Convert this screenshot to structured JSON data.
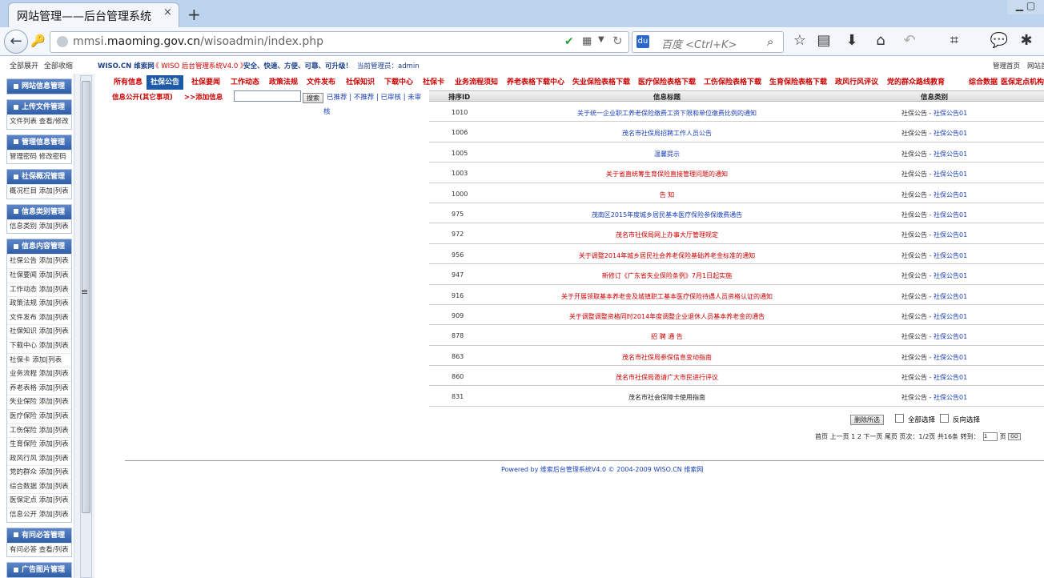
{
  "browser": {
    "tab_title": "网站管理——后台管理系统",
    "tab_close": "×",
    "new_tab": "+",
    "window_controls": "▁ ▢",
    "url_host_prefix": "mmsi.",
    "url_host_main": "maoming.gov.cn",
    "url_path": "/wisoadmin/index.php",
    "search_placeholder": "百度 <Ctrl+K>",
    "search_engine_label": "du"
  },
  "top_left": {
    "expand_all": "全部展开",
    "collapse_all": "全部收缩"
  },
  "header": {
    "brand": "WISO.CN 维索网",
    "version": "《 WISO 后台管理系统V4.0 》",
    "slogan": "安全、快速、方便、可靠、可升级！",
    "admin_label": "当前管理员：admin",
    "admin_home": "管理首页",
    "site_home": "网站首"
  },
  "sidebar": [
    {
      "title": "网站信息管理",
      "rows": []
    },
    {
      "title": "上传文件管理",
      "rows": [
        "文件列表  查看/修改"
      ]
    },
    {
      "title": "管理信息管理",
      "rows": [
        "管理密码  修改密码"
      ]
    },
    {
      "title": "社保概况管理",
      "rows": [
        "概况栏目   添加|列表"
      ]
    },
    {
      "title": "信息类别管理",
      "rows": [
        "信息类别  添加|列表"
      ]
    },
    {
      "title": "信息内容管理",
      "rows": [
        "社保公告  添加|列表",
        "社保要闻  添加|列表",
        "工作动态  添加|列表",
        "政策法规  添加|列表",
        "文件发布  添加|列表",
        "社保知识  添加|列表",
        "下载中心  添加|列表",
        "  社保卡  添加|列表",
        "业务流程  添加|列表",
        "养老表格  添加|列表",
        "失业保险  添加|列表",
        "医疗保险  添加|列表",
        "工伤保险  添加|列表",
        "生育保险  添加|列表",
        "政风行风  添加|列表",
        "党的群众  添加|列表",
        "综合数据  添加|列表",
        "医保定点  添加|列表",
        "信息公开  添加|列表"
      ]
    },
    {
      "title": "有问必答管理",
      "rows": [
        "有问必答  查看/列表"
      ]
    },
    {
      "title": "广告图片管理",
      "rows": []
    }
  ],
  "categories": [
    "所有信息",
    "社保公告",
    "社保要闻",
    "工作动态",
    "政策法规",
    "文件发布",
    "社保知识",
    "下载中心",
    "社保卡",
    "业务流程须知",
    "养老表格下载中心",
    "失业保险表格下载",
    "医疗保险表格下载",
    "工伤保险表格下载",
    "生育保险表格下载",
    "政风行风评议",
    "党的群众路线教育",
    "综合数据",
    "医保定点机构"
  ],
  "active_category": "社保公告",
  "row2": {
    "info_public": "信息公开(其它事项)",
    "add_info": ">>添加信息",
    "search_button": "搜索",
    "filters": "已推荐 | 不推荐 | 已审核 | 未审",
    "filters_wrap": "核"
  },
  "table": {
    "headers": {
      "id": "排序ID",
      "title": "信息标题",
      "category": "信息类别"
    },
    "rows": [
      {
        "id": "1010",
        "title": "关于统一企业职工养老保险缴费工资下限和单位缴费比例的通知",
        "color": "#1a3fb8"
      },
      {
        "id": "1006",
        "title": "茂名市社保局招聘工作人员公告",
        "color": "#1a3fb8"
      },
      {
        "id": "1005",
        "title": "温馨提示",
        "color": "#1a3fb8"
      },
      {
        "id": "1003",
        "title": "关于省直统筹生育保险直接管理问题的通知",
        "color": "#cc0000"
      },
      {
        "id": "1000",
        "title": "告 知",
        "color": "#cc0000"
      },
      {
        "id": "975",
        "title": "茂南区2015年度城乡居民基本医疗保险参保缴费通告",
        "color": "#1a3fb8"
      },
      {
        "id": "972",
        "title": "茂名市社保局网上办事大厅管理规定",
        "color": "#cc0000"
      },
      {
        "id": "956",
        "title": "关于调整2014年城乡居民社会养老保险基础养老金标准的通知",
        "color": "#cc0000"
      },
      {
        "id": "947",
        "title": "新修订《广东省失业保险条例》7月1日起实施",
        "color": "#cc0000"
      },
      {
        "id": "916",
        "title": "关于开展领取基本养老金及城镇职工基本医疗保险待遇人员资格认证的通知",
        "color": "#cc0000"
      },
      {
        "id": "909",
        "title": "关于调整调整资格同时2014年度调整企业退休人员基本养老金的通告",
        "color": "#cc0000"
      },
      {
        "id": "878",
        "title": "招 聘 通 告",
        "color": "#cc0000"
      },
      {
        "id": "863",
        "title": "茂名市社保局参保信息变动指南",
        "color": "#cc0000"
      },
      {
        "id": "860",
        "title": "茂名市社保局邀请广大市民进行评议",
        "color": "#cc0000"
      },
      {
        "id": "831",
        "title": "茂名市社会保障卡使用指南",
        "color": "#222222"
      }
    ],
    "cat_prefix": "社保公告 - ",
    "cat_link": "社保公告01"
  },
  "actions": {
    "delete": "删除所选",
    "select_all": "全部选择",
    "invert": "反向选择"
  },
  "pager": {
    "text": "首页 上一页 1 2 下一页 尾页 页次：1/2页 共16条 转到：",
    "page_value": "1",
    "suffix": "页",
    "go": "GO"
  },
  "footer": {
    "text": "Powered by 维索后台管理系统V4.0 © 2004-2009 WISO.CN 维索网"
  },
  "colors": {
    "accent": "#1c5aa8",
    "link": "#1a3fb8",
    "alert": "#cc0000"
  }
}
